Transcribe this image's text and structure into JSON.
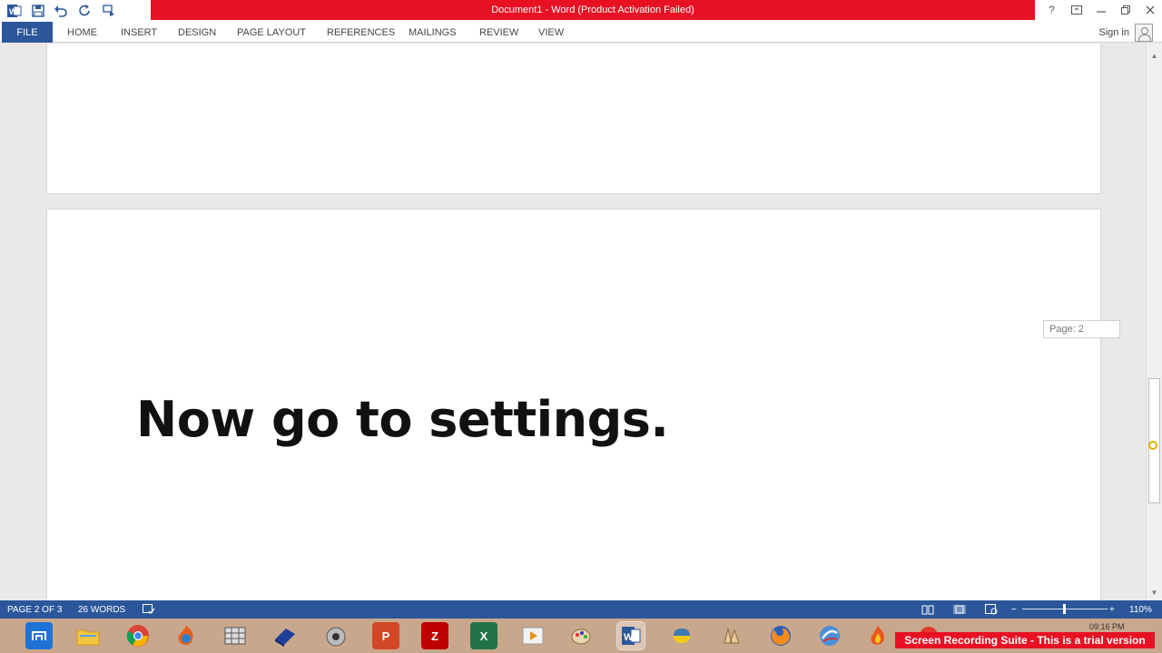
{
  "window": {
    "title": "Document1 -  Word (Product Activation Failed)",
    "title_bar_color": "#e81123",
    "controls": [
      "?",
      "restore-ribbon",
      "minimize",
      "maximize",
      "close"
    ]
  },
  "quick_access": {
    "icons": [
      "word-logo-icon",
      "save-icon",
      "undo-icon",
      "redo-icon",
      "touch-mode-icon"
    ]
  },
  "ribbon": {
    "file_label": "FILE",
    "tabs": [
      "HOME",
      "INSERT",
      "DESIGN",
      "PAGE LAYOUT",
      "REFERENCES",
      "MAILINGS",
      "REVIEW",
      "VIEW"
    ],
    "sign_in": "Sign in",
    "accent_color": "#2b579a"
  },
  "document": {
    "body_text": "Now go to settings.",
    "page_tooltip": "Page: 2"
  },
  "status": {
    "page": "PAGE 2 OF 3",
    "words": "26 WORDS",
    "zoom": "110%",
    "zoom_minus": "−",
    "zoom_plus": "+"
  },
  "taskbar": {
    "apps": [
      "start-button",
      "file-explorer",
      "chrome",
      "firefox-alt",
      "screen-tool",
      "dictionary",
      "media-tool",
      "powerpoint",
      "filezilla",
      "excel",
      "video-player",
      "paint",
      "word",
      "python",
      "lab-app",
      "firefox",
      "browser",
      "recorder",
      "recording-app"
    ],
    "clock": "09:16 PM"
  },
  "watermark": "Screen Recording Suite - This is a trial version"
}
